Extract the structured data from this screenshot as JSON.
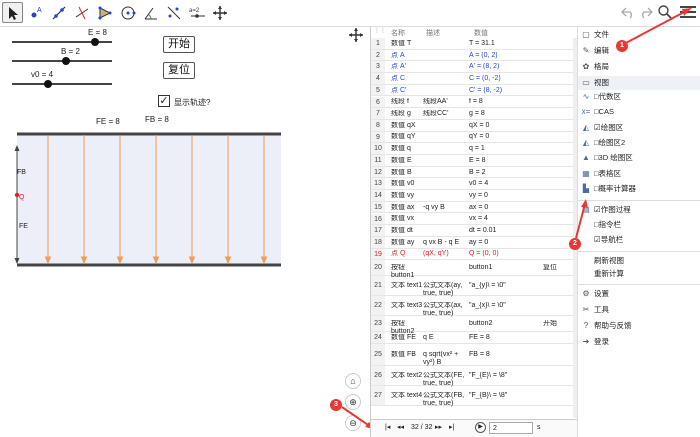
{
  "toolbar": {
    "ab2_label": "a=2",
    "undo": "undo",
    "redo": "redo"
  },
  "sliders": [
    {
      "label": "E = 8"
    },
    {
      "label": "B = 2"
    },
    {
      "label": "v0 = 4"
    }
  ],
  "buttons": {
    "start": "开始",
    "reset": "复位"
  },
  "checkbox": {
    "label": "显示轨迹?",
    "checked": "✓"
  },
  "field_labels": {
    "fe": "FE = 8",
    "fb": "FB = 8"
  },
  "graph_labels": {
    "fb": "FB",
    "q": "Q",
    "fe": "FE"
  },
  "algebra": {
    "headers": {
      "name": "名称",
      "desc": "描述",
      "value": "数值"
    },
    "rows": [
      {
        "n": "1",
        "name": "数值 T",
        "desc": "",
        "value": "T = 31.1",
        "cap": "",
        "style": ""
      },
      {
        "n": "2",
        "name": "点 A",
        "desc": "",
        "value": "A = (0, 2)",
        "cap": "",
        "style": "blue"
      },
      {
        "n": "3",
        "name": "点 A'",
        "desc": "",
        "value": "A' = (8, 2)",
        "cap": "",
        "style": "blue"
      },
      {
        "n": "4",
        "name": "点 C",
        "desc": "",
        "value": "C = (0, -2)",
        "cap": "",
        "style": "blue"
      },
      {
        "n": "5",
        "name": "点 C'",
        "desc": "",
        "value": "C' = (8, -2)",
        "cap": "",
        "style": "blue"
      },
      {
        "n": "6",
        "name": "线段 f",
        "desc": "线段AA'",
        "value": "f = 8",
        "cap": "",
        "style": ""
      },
      {
        "n": "7",
        "name": "线段 g",
        "desc": "线段CC'",
        "value": "g = 8",
        "cap": "",
        "style": ""
      },
      {
        "n": "8",
        "name": "数值 qX",
        "desc": "",
        "value": "qX = 0",
        "cap": "",
        "style": ""
      },
      {
        "n": "9",
        "name": "数值 qY",
        "desc": "",
        "value": "qY = 0",
        "cap": "",
        "style": ""
      },
      {
        "n": "10",
        "name": "数值 q",
        "desc": "",
        "value": "q = 1",
        "cap": "",
        "style": ""
      },
      {
        "n": "11",
        "name": "数值 E",
        "desc": "",
        "value": "E = 8",
        "cap": "",
        "style": ""
      },
      {
        "n": "12",
        "name": "数值 B",
        "desc": "",
        "value": "B = 2",
        "cap": "",
        "style": ""
      },
      {
        "n": "13",
        "name": "数值 v0",
        "desc": "",
        "value": "v0 = 4",
        "cap": "",
        "style": ""
      },
      {
        "n": "14",
        "name": "数值 vy",
        "desc": "",
        "value": "vy = 0",
        "cap": "",
        "style": ""
      },
      {
        "n": "15",
        "name": "数值 ax",
        "desc": "-q vy B",
        "value": "ax = 0",
        "cap": "",
        "style": ""
      },
      {
        "n": "16",
        "name": "数值 vx",
        "desc": "",
        "value": "vx = 4",
        "cap": "",
        "style": ""
      },
      {
        "n": "17",
        "name": "数值 dt",
        "desc": "",
        "value": "dt = 0.01",
        "cap": "",
        "style": ""
      },
      {
        "n": "18",
        "name": "数值 ay",
        "desc": "q vx B - q E",
        "value": "ay = 0",
        "cap": "",
        "style": ""
      },
      {
        "n": "19",
        "name": "点 Q",
        "desc": "(qX, qY)",
        "value": "Q = (0, 0)",
        "cap": "",
        "style": "red"
      },
      {
        "n": "20",
        "name": "按钮 button1",
        "desc": "",
        "value": "button1",
        "cap": "复位",
        "style": ""
      },
      {
        "n": "21",
        "name": "文本 text1",
        "desc": "公式文本(ay, true, true)",
        "value": "\"a_{y}\\ = \\0\"",
        "cap": "",
        "style": ""
      },
      {
        "n": "22",
        "name": "文本 text3",
        "desc": "公式文本(ax, true, true)",
        "value": "\"a_{x}\\ = \\0\"",
        "cap": "",
        "style": ""
      },
      {
        "n": "23",
        "name": "按钮 button2",
        "desc": "",
        "value": "button2",
        "cap": "开始",
        "style": ""
      },
      {
        "n": "24",
        "name": "数值 FE",
        "desc": "q E",
        "value": "FE = 8",
        "cap": "",
        "style": ""
      },
      {
        "n": "25",
        "name": "数值 FB",
        "desc": "q sqrt(vx² + vy²) B",
        "value": "FB = 8",
        "cap": "",
        "style": ""
      },
      {
        "n": "26",
        "name": "文本 text2",
        "desc": "公式文本(FE, true, true)",
        "value": "\"F_{E}\\ = \\8\"",
        "cap": "",
        "style": ""
      },
      {
        "n": "27",
        "name": "文本 text4",
        "desc": "公式文本(FB, true, true)",
        "value": "\"F_{B}\\ = \\8\"",
        "cap": "",
        "style": ""
      }
    ],
    "nav": {
      "step": "32 / 32",
      "speed": "2",
      "unit": "s"
    }
  },
  "menu": {
    "items": [
      {
        "icon": "file-icon",
        "glyph": "▢",
        "label": "文件"
      },
      {
        "icon": "edit-icon",
        "glyph": "✎",
        "label": "编辑"
      },
      {
        "icon": "layout-icon",
        "glyph": "✿",
        "label": "格局"
      },
      {
        "icon": "view-icon",
        "glyph": "▭",
        "label": "视图"
      }
    ],
    "view_items": [
      {
        "icon": "algebra-icon",
        "glyph": "∿",
        "label": "□代数区"
      },
      {
        "icon": "cas-icon",
        "glyph": "x=",
        "label": "□CAS"
      },
      {
        "icon": "graphics-icon",
        "glyph": "◭",
        "label": "☑绘图区"
      },
      {
        "icon": "graphics2-icon",
        "glyph": "◭",
        "label": "□绘图区2"
      },
      {
        "icon": "3d-icon",
        "glyph": "▲",
        "label": "□3D 绘图区"
      },
      {
        "icon": "spreadsheet-icon",
        "glyph": "▦",
        "label": "□表格区"
      },
      {
        "icon": "probability-icon",
        "glyph": "▙",
        "label": "□概率计算器"
      }
    ],
    "view_items2": [
      {
        "icon": "construction-protocol-icon",
        "glyph": "▤",
        "label": "☑作图过程"
      },
      {
        "icon": "input-bar-icon",
        "glyph": "",
        "label": "□指令栏"
      },
      {
        "icon": "navigation-bar-icon",
        "glyph": "",
        "label": "☑导航栏"
      }
    ],
    "actions": [
      "刷新视图",
      "重新计算"
    ],
    "bottom": [
      {
        "icon": "settings-icon",
        "glyph": "⚙",
        "label": "设置"
      },
      {
        "icon": "tools-icon",
        "glyph": "✂",
        "label": "工具"
      },
      {
        "icon": "help-icon",
        "glyph": "?",
        "label": "帮助与反馈"
      },
      {
        "icon": "signin-icon",
        "glyph": "➜",
        "label": "登录"
      }
    ]
  },
  "badges": [
    "1",
    "2",
    "3"
  ]
}
